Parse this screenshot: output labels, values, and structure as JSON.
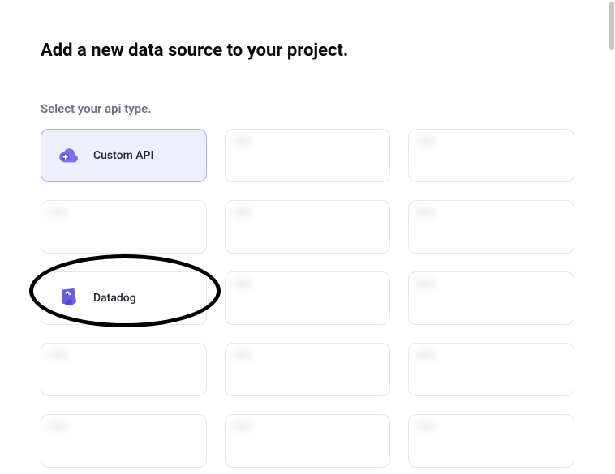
{
  "title": "Add a new data source to your project.",
  "subtitle": "Select your api type.",
  "colors": {
    "accent": "#6a5fe0",
    "selected_bg": "#eef0fe",
    "selected_border": "#a8b1f5"
  },
  "options": [
    {
      "id": "custom-api",
      "label": "Custom API",
      "icon": "cloud-plus-icon",
      "selected": true
    },
    {
      "id": "opt2",
      "label": "",
      "icon": "blank-icon",
      "selected": false
    },
    {
      "id": "opt3",
      "label": "",
      "icon": "blank-icon",
      "selected": false
    },
    {
      "id": "opt4",
      "label": "",
      "icon": "blank-icon",
      "selected": false
    },
    {
      "id": "opt5",
      "label": "",
      "icon": "blank-icon",
      "selected": false
    },
    {
      "id": "opt6",
      "label": "",
      "icon": "blank-icon",
      "selected": false
    },
    {
      "id": "datadog",
      "label": "Datadog",
      "icon": "datadog-icon",
      "selected": false
    },
    {
      "id": "opt8",
      "label": "",
      "icon": "blank-icon",
      "selected": false
    },
    {
      "id": "opt9",
      "label": "",
      "icon": "blank-icon",
      "selected": false
    },
    {
      "id": "opt10",
      "label": "",
      "icon": "blank-icon",
      "selected": false
    },
    {
      "id": "opt11",
      "label": "",
      "icon": "blank-icon",
      "selected": false
    },
    {
      "id": "opt12",
      "label": "",
      "icon": "blank-icon",
      "selected": false
    },
    {
      "id": "opt13",
      "label": "",
      "icon": "blank-icon",
      "selected": false
    },
    {
      "id": "opt14",
      "label": "",
      "icon": "blank-icon",
      "selected": false
    },
    {
      "id": "opt15",
      "label": "",
      "icon": "blank-icon",
      "selected": false
    }
  ]
}
